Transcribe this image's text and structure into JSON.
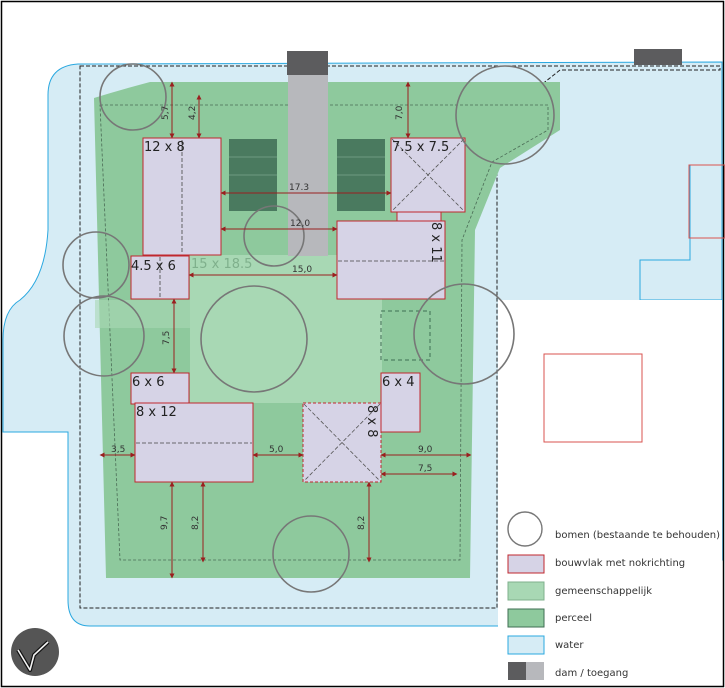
{
  "colors": {
    "water": "#d6ecf5",
    "water_edge": "#2aa8e0",
    "plot": "#8ec99d",
    "communal": "#a8d8b4",
    "building_fill": "#d6d3e6",
    "building_edge": "#c0272d",
    "dam_dark": "#5c5c5e",
    "dam_light": "#b7b8bc",
    "tree": "#777777",
    "parking": "#4a7a5f",
    "dimension": "#9a1f1f",
    "frame": "#000000"
  },
  "buildings": [
    {
      "id": "b1",
      "label": "12 x 8"
    },
    {
      "id": "b2",
      "label": "7.5 x 7.5"
    },
    {
      "id": "b3",
      "label": "8 x 11"
    },
    {
      "id": "b4",
      "label": "4.5 x 6"
    },
    {
      "id": "b5",
      "label": "6 x 6"
    },
    {
      "id": "b6",
      "label": "8 x 12"
    },
    {
      "id": "b7",
      "label": "8 x 8"
    },
    {
      "id": "b8",
      "label": "6 x 4"
    }
  ],
  "communal_area": {
    "label": "15 x 18.5"
  },
  "dimensions": [
    {
      "id": "d1",
      "value": "5,7"
    },
    {
      "id": "d2",
      "value": "4,2"
    },
    {
      "id": "d3",
      "value": "7,0"
    },
    {
      "id": "d4",
      "value": "17.3"
    },
    {
      "id": "d5",
      "value": "12,0"
    },
    {
      "id": "d6",
      "value": "15,0"
    },
    {
      "id": "d7",
      "value": "7,5"
    },
    {
      "id": "d8",
      "value": "3,5"
    },
    {
      "id": "d9",
      "value": "5,0"
    },
    {
      "id": "d10",
      "value": "9,0"
    },
    {
      "id": "d11",
      "value": "7,5"
    },
    {
      "id": "d12",
      "value": "9,7"
    },
    {
      "id": "d13",
      "value": "8,2"
    },
    {
      "id": "d14",
      "value": "8,2"
    }
  ],
  "legend": [
    {
      "key": "trees",
      "label": "bomen (bestaande te behouden)"
    },
    {
      "key": "building",
      "label": "bouwvlak met nokrichting"
    },
    {
      "key": "communal",
      "label": "gemeenschappelijk"
    },
    {
      "key": "plot",
      "label": "perceel"
    },
    {
      "key": "water",
      "label": "water"
    },
    {
      "key": "dam",
      "label": "dam / toegang"
    }
  ],
  "north_arrow": {
    "icon": "north-arrow-icon"
  }
}
